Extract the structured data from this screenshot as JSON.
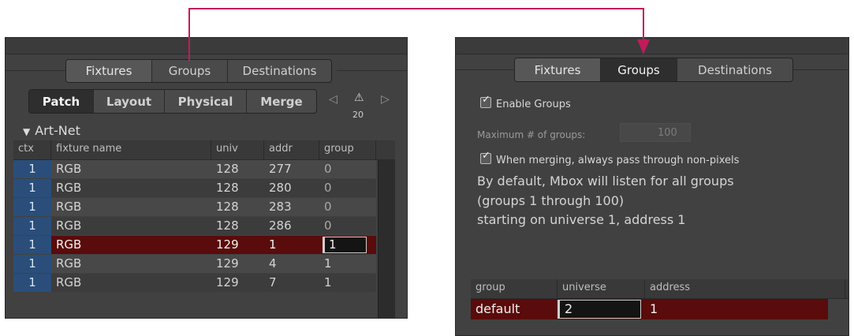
{
  "colors": {
    "annotation": "#c21a5c",
    "selected_row": "#5a0b0b",
    "ctx_badge": "#2a4e79"
  },
  "left": {
    "top_tabs": [
      "Fixtures",
      "Groups",
      "Destinations"
    ],
    "sub_tabs": [
      "Patch",
      "Layout",
      "Physical",
      "Merge"
    ],
    "selected_sub_tab": "Patch",
    "prev_arrow": "◁",
    "next_arrow": "▷",
    "warning_icon": "⚠",
    "warning_count": "20",
    "section_title": "Art-Net",
    "columns": [
      "ctx",
      "fixture name",
      "univ",
      "addr",
      "group"
    ],
    "rows": [
      {
        "ctx": "1",
        "name": "RGB",
        "univ": "128",
        "addr": "277",
        "group": "0"
      },
      {
        "ctx": "1",
        "name": "RGB",
        "univ": "128",
        "addr": "280",
        "group": "0"
      },
      {
        "ctx": "1",
        "name": "RGB",
        "univ": "128",
        "addr": "283",
        "group": "0"
      },
      {
        "ctx": "1",
        "name": "RGB",
        "univ": "128",
        "addr": "286",
        "group": "0"
      },
      {
        "ctx": "1",
        "name": "RGB",
        "univ": "129",
        "addr": "1",
        "group": "1"
      },
      {
        "ctx": "1",
        "name": "RGB",
        "univ": "129",
        "addr": "4",
        "group": "1"
      },
      {
        "ctx": "1",
        "name": "RGB",
        "univ": "129",
        "addr": "7",
        "group": "1"
      }
    ],
    "selected_row_index": 4
  },
  "right": {
    "top_tabs": [
      "Fixtures",
      "Groups",
      "Destinations"
    ],
    "enable_groups": "Enable Groups",
    "max_groups_label": "Maximum # of groups:",
    "max_groups_value": "100",
    "merge_passthrough": "When merging, always pass through non-pixels",
    "info_lines": [
      "By default, Mbox will listen for all groups",
      "(groups 1 through 100)",
      "starting on universe 1, address 1"
    ],
    "columns": [
      "group",
      "universe",
      "address"
    ],
    "row": {
      "group": "default",
      "universe": "2",
      "address": "1"
    }
  }
}
